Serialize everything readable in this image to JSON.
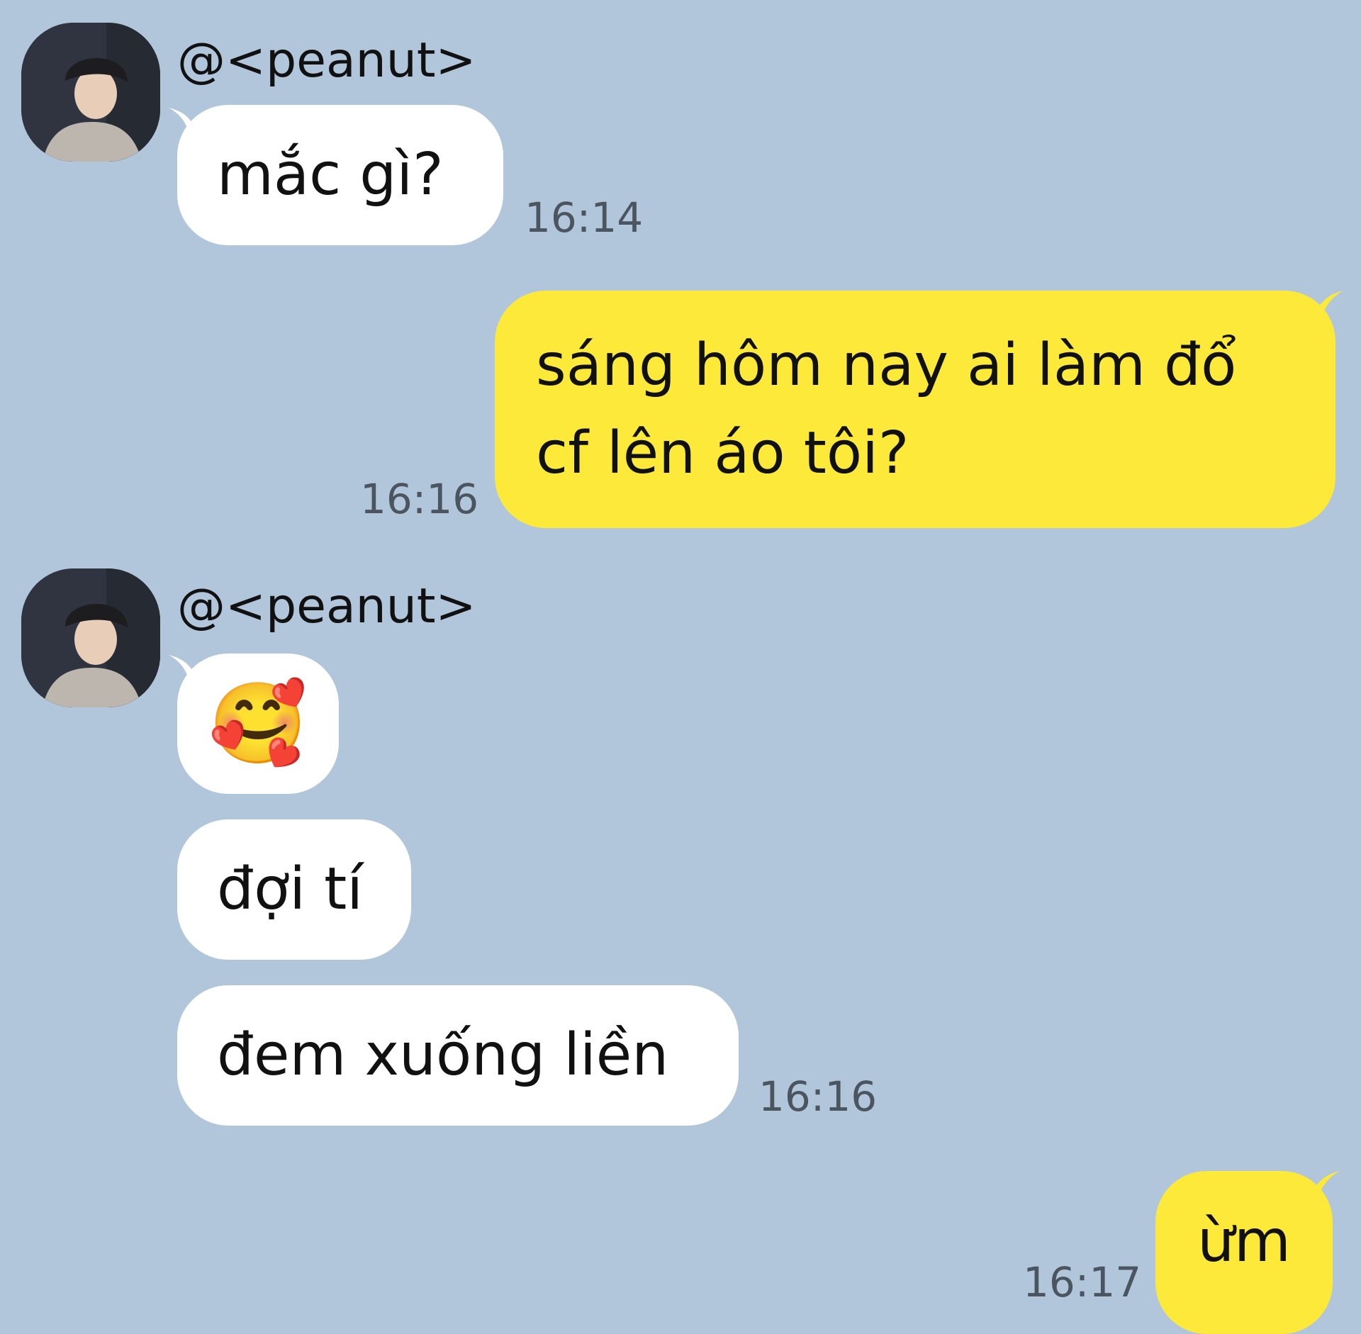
{
  "messages": [
    {
      "sender": "@<peanut>",
      "text": "mắc gì?",
      "time": "16:14"
    },
    {
      "text": "sáng hôm nay ai làm đổ\ncf lên áo tôi?",
      "line1": "sáng hôm nay ai làm đổ",
      "line2": "cf lên áo tôi?",
      "time": "16:16"
    },
    {
      "sender": "@<peanut>",
      "emoji": "🥰",
      "text2": "đợi tí",
      "text3": "đem xuống liền",
      "time": "16:16"
    },
    {
      "text": "ừm",
      "time": "16:17"
    }
  ],
  "colors": {
    "background": "#b1c6db",
    "incoming": "#ffffff",
    "outgoing": "#fde93a"
  },
  "icons": {
    "avatar": "profile-photo"
  }
}
